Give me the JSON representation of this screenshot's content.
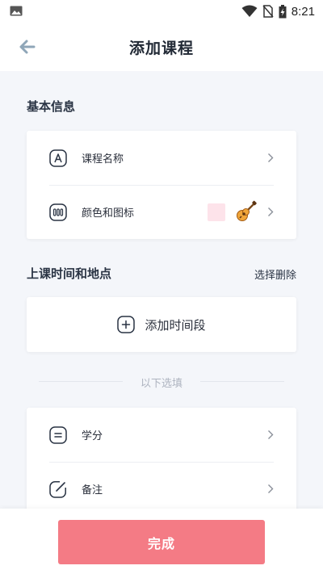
{
  "status_bar": {
    "time": "8:21",
    "icons": [
      "image-icon",
      "wifi-icon",
      "no-sim-icon",
      "battery-charging-icon"
    ]
  },
  "header": {
    "title": "添加课程",
    "back_icon": "back-arrow-icon"
  },
  "basic_info": {
    "section_title": "基本信息",
    "rows": [
      {
        "icon": "letter-a-icon",
        "label": "课程名称"
      },
      {
        "icon": "color-palette-icon",
        "label": "颜色和图标",
        "color_swatch": "#fde3ea",
        "course_icon": "guitar-icon"
      }
    ]
  },
  "time_place": {
    "section_title": "上课时间和地点",
    "action_label": "选择删除",
    "add_label": "添加时间段"
  },
  "optional": {
    "divider_label": "以下选填",
    "rows": [
      {
        "icon": "credit-icon",
        "label": "学分"
      },
      {
        "icon": "note-edit-icon",
        "label": "备注"
      }
    ]
  },
  "footer": {
    "done_label": "完成",
    "accent_color": "#f47b85"
  }
}
